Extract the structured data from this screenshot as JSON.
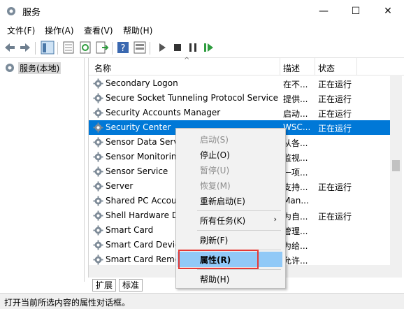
{
  "window": {
    "title": "服务",
    "minimize": "—",
    "maximize": "☐",
    "close": "✕"
  },
  "menu": [
    "文件(F)",
    "操作(A)",
    "查看(V)",
    "帮助(H)"
  ],
  "tree": {
    "root_label": "服务(本地)"
  },
  "columns": {
    "name": "名称",
    "desc": "描述",
    "status": "状态"
  },
  "rows": [
    {
      "name": "Secondary Logon",
      "desc": "在不...",
      "status": "正在运行"
    },
    {
      "name": "Secure Socket Tunneling Protocol Service",
      "desc": "提供...",
      "status": "正在运行"
    },
    {
      "name": "Security Accounts Manager",
      "desc": "启动...",
      "status": "正在运行"
    },
    {
      "name": "Security Center",
      "desc": "WSC...",
      "status": "正在运行"
    },
    {
      "name": "Sensor Data Serv",
      "desc": "从各...",
      "status": ""
    },
    {
      "name": "Sensor Monitorin",
      "desc": "监视...",
      "status": ""
    },
    {
      "name": "Sensor Service",
      "desc": "一项...",
      "status": ""
    },
    {
      "name": "Server",
      "desc": "支持...",
      "status": "正在运行"
    },
    {
      "name": "Shared PC Accou",
      "desc": "Man...",
      "status": ""
    },
    {
      "name": "Shell Hardware D",
      "desc": "为自...",
      "status": "正在运行"
    },
    {
      "name": "Smart Card",
      "desc": "管理...",
      "status": ""
    },
    {
      "name": "Smart Card Devic",
      "desc": "为给...",
      "status": ""
    },
    {
      "name": "Smart Card Remo",
      "desc": "允许...",
      "status": ""
    }
  ],
  "selected_row_index": 3,
  "tabs": {
    "extended": "扩展",
    "standard": "标准"
  },
  "status_bar": "打开当前所选内容的属性对话框。",
  "context_menu": {
    "start": "启动(S)",
    "stop": "停止(O)",
    "pause": "暂停(U)",
    "resume": "恢复(M)",
    "restart": "重新启动(E)",
    "all_tasks": "所有任务(K)",
    "all_tasks_arrow": "›",
    "refresh": "刷新(F)",
    "properties": "属性(R)",
    "help": "帮助(H)"
  },
  "colors": {
    "selection": "#0078d7",
    "highlight": "#91c9f7",
    "callout": "#e53935"
  }
}
